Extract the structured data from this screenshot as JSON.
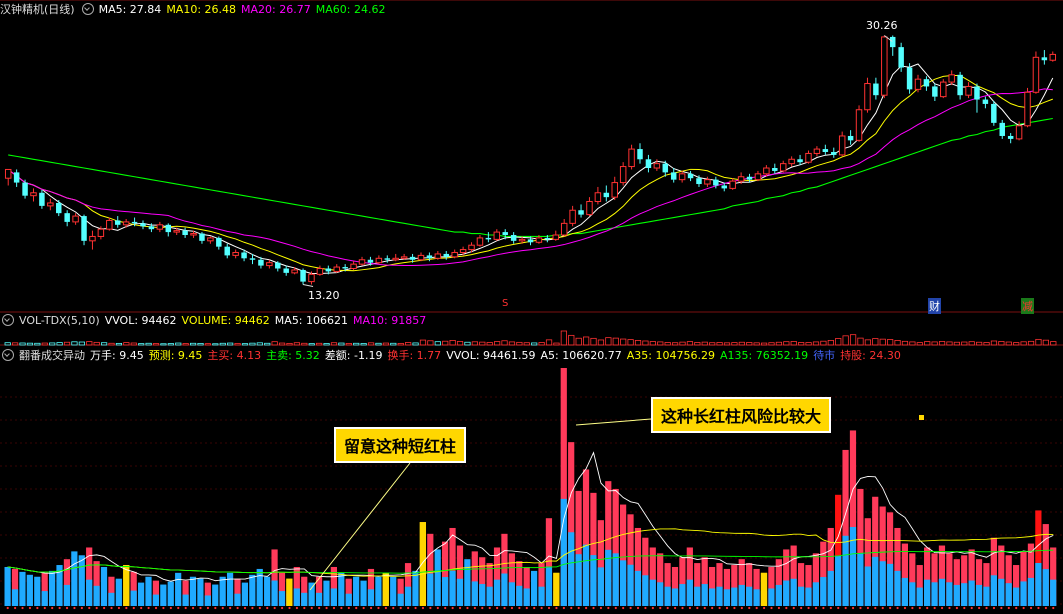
{
  "price_header": {
    "title": "汉钟精机(日线)",
    "ma5": "MA5: 27.84",
    "ma10": "MA10: 26.48",
    "ma20": "MA20: 26.77",
    "ma60": "MA60: 24.62"
  },
  "vol_header": {
    "title": "VOL-TDX(5,10)",
    "vvol": "VVOL: 94462",
    "volume": "VOLUME: 94462",
    "ma5": "MA5: 106621",
    "ma10": "MA10: 91857"
  },
  "ind_header": {
    "title": "翻番成交异动",
    "wanshou": "万手: 9.45",
    "yuce": "预测: 9.45",
    "zhumai": "主买: 4.13",
    "zhumai2": "主卖: 5.32",
    "chae": "差额: -1.19",
    "huanshou": "换手: 1.77",
    "vvol": "VVOL: 94461.59",
    "a5": "A5: 106620.77",
    "a35": "A35: 104756.29",
    "a135": "A135: 76352.19",
    "daishi": "待市",
    "chigu": "持股: 24.30"
  },
  "annotations": {
    "short_red": "留意这种短红柱",
    "long_red": "这种长红柱风险比较大"
  },
  "markers": {
    "s_mark": "S",
    "cai": "财",
    "jian": "减"
  },
  "chart_data": {
    "type": "candlestick",
    "high_label": "30.26",
    "low_label": "13.20",
    "colors": {
      "up": "#ff3232",
      "down": "#54ffff",
      "ma5": "#ffffff",
      "ma10": "#ffff00",
      "ma20": "#ff00ff",
      "ma60": "#00ff00"
    },
    "price_range": [
      12.0,
      31.5
    ],
    "candles": [
      [
        20.5,
        21.1,
        20.9,
        20.0
      ],
      [
        20.9,
        20.2,
        21.1,
        19.9
      ],
      [
        20.2,
        19.3,
        20.4,
        19.1
      ],
      [
        19.3,
        19.5,
        19.8,
        18.9
      ],
      [
        19.5,
        18.6,
        19.7,
        18.4
      ],
      [
        18.6,
        18.8,
        19.1,
        18.3
      ],
      [
        18.8,
        18.1,
        19.0,
        17.9
      ],
      [
        18.1,
        17.5,
        18.3,
        17.2
      ],
      [
        17.5,
        17.9,
        18.1,
        17.3
      ],
      [
        17.9,
        16.2,
        18.0,
        15.9
      ],
      [
        16.2,
        16.5,
        16.9,
        15.6
      ],
      [
        16.5,
        17.0,
        17.2,
        16.3
      ],
      [
        17.0,
        17.6,
        17.8,
        16.9
      ],
      [
        17.6,
        17.3,
        17.9,
        17.1
      ],
      [
        17.3,
        17.5,
        17.7,
        17.1
      ],
      [
        17.5,
        17.4,
        17.8,
        17.2
      ],
      [
        17.4,
        17.2,
        17.6,
        17.0
      ],
      [
        17.2,
        17.0,
        17.4,
        16.8
      ],
      [
        17.0,
        17.3,
        17.5,
        16.8
      ],
      [
        17.3,
        16.8,
        17.4,
        16.5
      ],
      [
        16.8,
        16.9,
        17.1,
        16.6
      ],
      [
        16.9,
        16.6,
        17.1,
        16.4
      ],
      [
        16.6,
        16.7,
        16.9,
        16.4
      ],
      [
        16.7,
        16.2,
        16.8,
        16.0
      ],
      [
        16.2,
        16.4,
        16.5,
        16.0
      ],
      [
        16.4,
        15.8,
        16.5,
        15.6
      ],
      [
        15.8,
        15.2,
        16.0,
        15.0
      ],
      [
        15.2,
        15.4,
        15.6,
        15.0
      ],
      [
        15.4,
        15.0,
        15.6,
        14.8
      ],
      [
        15.0,
        14.9,
        15.3,
        14.6
      ],
      [
        14.9,
        14.5,
        15.1,
        14.3
      ],
      [
        14.5,
        14.7,
        14.9,
        14.3
      ],
      [
        14.7,
        14.3,
        14.8,
        14.1
      ],
      [
        14.3,
        14.0,
        14.5,
        13.8
      ],
      [
        14.0,
        14.2,
        14.4,
        13.9
      ],
      [
        14.2,
        13.4,
        14.3,
        13.2
      ],
      [
        13.4,
        13.9,
        14.1,
        13.2
      ],
      [
        13.9,
        14.3,
        14.5,
        13.8
      ],
      [
        14.3,
        14.1,
        14.5,
        13.9
      ],
      [
        14.1,
        14.4,
        14.6,
        14.0
      ],
      [
        14.4,
        14.3,
        14.6,
        14.1
      ],
      [
        14.3,
        14.6,
        14.8,
        14.2
      ],
      [
        14.6,
        14.9,
        15.1,
        14.5
      ],
      [
        14.9,
        14.7,
        15.1,
        14.5
      ],
      [
        14.7,
        15.0,
        15.2,
        14.6
      ],
      [
        15.0,
        14.9,
        15.2,
        14.7
      ],
      [
        14.9,
        15.0,
        15.3,
        14.8
      ],
      [
        15.0,
        15.1,
        15.3,
        14.9
      ],
      [
        15.1,
        14.9,
        15.3,
        14.7
      ],
      [
        14.9,
        15.2,
        15.4,
        14.8
      ],
      [
        15.2,
        15.0,
        15.4,
        14.8
      ],
      [
        15.0,
        15.3,
        15.5,
        14.9
      ],
      [
        15.3,
        15.1,
        15.5,
        14.9
      ],
      [
        15.1,
        15.4,
        15.6,
        15.0
      ],
      [
        15.4,
        15.6,
        15.8,
        15.2
      ],
      [
        15.6,
        15.9,
        16.1,
        15.4
      ],
      [
        15.9,
        16.4,
        16.6,
        15.8
      ],
      [
        16.4,
        16.3,
        16.8,
        16.1
      ],
      [
        16.3,
        16.8,
        17.0,
        16.2
      ],
      [
        16.8,
        16.6,
        17.0,
        16.3
      ],
      [
        16.6,
        16.2,
        16.8,
        16.0
      ],
      [
        16.2,
        16.3,
        16.5,
        16.0
      ],
      [
        16.3,
        16.1,
        16.5,
        15.9
      ],
      [
        16.1,
        16.4,
        16.6,
        16.0
      ],
      [
        16.4,
        16.3,
        16.6,
        16.1
      ],
      [
        16.3,
        16.6,
        16.9,
        16.2
      ],
      [
        16.6,
        17.4,
        17.7,
        16.5
      ],
      [
        17.4,
        18.3,
        18.6,
        17.2
      ],
      [
        18.3,
        18.0,
        18.7,
        17.8
      ],
      [
        18.0,
        18.9,
        19.2,
        17.9
      ],
      [
        18.9,
        19.5,
        19.9,
        18.7
      ],
      [
        19.5,
        19.2,
        20.0,
        18.9
      ],
      [
        19.2,
        20.2,
        20.6,
        19.0
      ],
      [
        20.2,
        21.3,
        21.6,
        20.0
      ],
      [
        21.3,
        22.5,
        22.8,
        21.1
      ],
      [
        22.5,
        21.8,
        22.9,
        21.5
      ],
      [
        21.8,
        21.2,
        22.1,
        20.9
      ],
      [
        21.2,
        21.5,
        21.8,
        21.0
      ],
      [
        21.5,
        20.9,
        21.7,
        20.6
      ],
      [
        20.9,
        20.4,
        21.2,
        20.2
      ],
      [
        20.4,
        20.8,
        21.0,
        20.2
      ],
      [
        20.8,
        20.5,
        21.0,
        20.3
      ],
      [
        20.5,
        20.1,
        20.7,
        19.9
      ],
      [
        20.1,
        20.4,
        20.6,
        19.9
      ],
      [
        20.4,
        20.0,
        20.6,
        19.8
      ],
      [
        20.0,
        19.8,
        20.2,
        19.6
      ],
      [
        19.8,
        20.3,
        20.5,
        19.7
      ],
      [
        20.3,
        20.6,
        20.9,
        20.1
      ],
      [
        20.6,
        20.4,
        20.8,
        20.2
      ],
      [
        20.4,
        20.8,
        21.0,
        20.3
      ],
      [
        20.8,
        21.2,
        21.4,
        20.6
      ],
      [
        21.2,
        21.0,
        21.5,
        20.8
      ],
      [
        21.0,
        21.5,
        21.7,
        20.9
      ],
      [
        21.5,
        21.8,
        22.0,
        21.3
      ],
      [
        21.8,
        21.6,
        22.1,
        21.4
      ],
      [
        21.6,
        22.2,
        22.4,
        21.5
      ],
      [
        22.2,
        22.5,
        22.7,
        22.0
      ],
      [
        22.5,
        22.3,
        22.8,
        22.1
      ],
      [
        22.3,
        22.1,
        22.6,
        21.9
      ],
      [
        22.1,
        23.4,
        23.7,
        22.0
      ],
      [
        23.4,
        23.1,
        23.8,
        22.8
      ],
      [
        23.1,
        25.2,
        25.5,
        23.0
      ],
      [
        25.2,
        27.0,
        27.4,
        25.0
      ],
      [
        27.0,
        26.2,
        27.4,
        25.9
      ],
      [
        26.2,
        30.2,
        30.3,
        26.0
      ],
      [
        30.2,
        29.5,
        30.3,
        28.9
      ],
      [
        29.5,
        28.1,
        29.8,
        27.8
      ],
      [
        28.1,
        26.6,
        28.4,
        26.3
      ],
      [
        26.6,
        27.3,
        27.6,
        26.4
      ],
      [
        27.3,
        26.8,
        27.5,
        26.5
      ],
      [
        26.8,
        26.1,
        27.0,
        25.8
      ],
      [
        26.1,
        27.1,
        27.3,
        26.0
      ],
      [
        27.1,
        27.6,
        27.9,
        26.9
      ],
      [
        27.6,
        26.2,
        27.8,
        25.9
      ],
      [
        26.2,
        26.8,
        27.1,
        26.0
      ],
      [
        26.8,
        25.9,
        27.0,
        25.0
      ],
      [
        25.9,
        25.6,
        26.1,
        25.3
      ],
      [
        25.6,
        24.3,
        25.8,
        24.1
      ],
      [
        24.3,
        23.4,
        24.5,
        23.2
      ],
      [
        23.4,
        23.2,
        23.6,
        22.9
      ],
      [
        23.2,
        24.1,
        24.4,
        23.1
      ],
      [
        24.1,
        26.4,
        26.7,
        24.0
      ],
      [
        26.4,
        28.8,
        29.2,
        26.3
      ],
      [
        28.8,
        28.6,
        29.3,
        28.3
      ],
      [
        28.6,
        29.0,
        29.2,
        28.5
      ]
    ],
    "ma60": [
      22.1,
      22.0,
      21.9,
      21.8,
      21.7,
      21.6,
      21.5,
      21.4,
      21.3,
      21.2,
      21.1,
      21.0,
      20.9,
      20.8,
      20.7,
      20.6,
      20.5,
      20.4,
      20.3,
      20.2,
      20.1,
      20.0,
      19.9,
      19.8,
      19.7,
      19.6,
      19.5,
      19.4,
      19.3,
      19.2,
      19.1,
      19.0,
      18.9,
      18.8,
      18.7,
      18.6,
      18.5,
      18.4,
      18.3,
      18.2,
      18.1,
      18.0,
      17.9,
      17.8,
      17.7,
      17.6,
      17.5,
      17.4,
      17.3,
      17.2,
      17.1,
      17.0,
      16.9,
      16.8,
      16.8,
      16.7,
      16.7,
      16.6,
      16.6,
      16.5,
      16.5,
      16.5,
      16.5,
      16.5,
      16.5,
      16.6,
      16.6,
      16.7,
      16.7,
      16.8,
      16.9,
      17.0,
      17.1,
      17.2,
      17.3,
      17.4,
      17.5,
      17.6,
      17.7,
      17.8,
      17.9,
      18.0,
      18.1,
      18.2,
      18.3,
      18.4,
      18.6,
      18.7,
      18.8,
      18.9,
      19.1,
      19.2,
      19.3,
      19.5,
      19.6,
      19.8,
      19.9,
      20.1,
      20.3,
      20.5,
      20.7,
      20.9,
      21.1,
      21.3,
      21.5,
      21.7,
      21.9,
      22.1,
      22.3,
      22.5,
      22.7,
      22.9,
      23.1,
      23.2,
      23.4,
      23.5,
      23.7,
      23.8,
      24.0,
      24.1,
      24.2,
      24.3,
      24.4,
      24.5,
      24.6
    ],
    "vol_bars": [
      [
        40,
        "b"
      ],
      [
        38,
        "r"
      ],
      [
        35,
        "b"
      ],
      [
        32,
        "b"
      ],
      [
        30,
        "b"
      ],
      [
        34,
        "r"
      ],
      [
        36,
        "b"
      ],
      [
        42,
        "b"
      ],
      [
        48,
        "r"
      ],
      [
        56,
        "b"
      ],
      [
        52,
        "b"
      ],
      [
        60,
        "r"
      ],
      [
        46,
        "r"
      ],
      [
        40,
        "b"
      ],
      [
        30,
        "r"
      ],
      [
        28,
        "b"
      ],
      [
        42,
        "y"
      ],
      [
        35,
        "r"
      ],
      [
        24,
        "b"
      ],
      [
        30,
        "b"
      ],
      [
        26,
        "r"
      ],
      [
        22,
        "b"
      ],
      [
        25,
        "b"
      ],
      [
        34,
        "b"
      ],
      [
        26,
        "r"
      ],
      [
        30,
        "b"
      ],
      [
        28,
        "b"
      ],
      [
        24,
        "r"
      ],
      [
        22,
        "b"
      ],
      [
        30,
        "b"
      ],
      [
        34,
        "b"
      ],
      [
        28,
        "r"
      ],
      [
        24,
        "b"
      ],
      [
        32,
        "b"
      ],
      [
        38,
        "b"
      ],
      [
        30,
        "b"
      ],
      [
        58,
        "r"
      ],
      [
        34,
        "r"
      ],
      [
        28,
        "y"
      ],
      [
        40,
        "r"
      ],
      [
        30,
        "r"
      ],
      [
        24,
        "b"
      ],
      [
        30,
        "r"
      ],
      [
        26,
        "b"
      ],
      [
        40,
        "r"
      ],
      [
        34,
        "b"
      ],
      [
        28,
        "r"
      ],
      [
        30,
        "b"
      ],
      [
        26,
        "b"
      ],
      [
        38,
        "r"
      ],
      [
        30,
        "b"
      ],
      [
        34,
        "y"
      ],
      [
        30,
        "b"
      ],
      [
        28,
        "r"
      ],
      [
        44,
        "r"
      ],
      [
        36,
        "b"
      ],
      [
        86,
        "y"
      ],
      [
        74,
        "r"
      ],
      [
        58,
        "b"
      ],
      [
        66,
        "r"
      ],
      [
        80,
        "r"
      ],
      [
        62,
        "r"
      ],
      [
        48,
        "b"
      ],
      [
        56,
        "r"
      ],
      [
        50,
        "r"
      ],
      [
        44,
        "r"
      ],
      [
        60,
        "r"
      ],
      [
        74,
        "r"
      ],
      [
        54,
        "r"
      ],
      [
        46,
        "r"
      ],
      [
        40,
        "r"
      ],
      [
        36,
        "b"
      ],
      [
        44,
        "r"
      ],
      [
        90,
        "r"
      ],
      [
        34,
        "y"
      ],
      [
        244,
        "r"
      ],
      [
        168,
        "r"
      ],
      [
        118,
        "r"
      ],
      [
        140,
        "r"
      ],
      [
        116,
        "r"
      ],
      [
        88,
        "r"
      ],
      [
        128,
        "r"
      ],
      [
        120,
        "r"
      ],
      [
        104,
        "r"
      ],
      [
        94,
        "r"
      ],
      [
        80,
        "r"
      ],
      [
        70,
        "r"
      ],
      [
        60,
        "r"
      ],
      [
        54,
        "r"
      ],
      [
        44,
        "r"
      ],
      [
        40,
        "r"
      ],
      [
        50,
        "r"
      ],
      [
        60,
        "r"
      ],
      [
        44,
        "r"
      ],
      [
        50,
        "r"
      ],
      [
        40,
        "r"
      ],
      [
        44,
        "r"
      ],
      [
        38,
        "r"
      ],
      [
        42,
        "r"
      ],
      [
        48,
        "r"
      ],
      [
        44,
        "r"
      ],
      [
        38,
        "r"
      ],
      [
        34,
        "y"
      ],
      [
        40,
        "r"
      ],
      [
        48,
        "r"
      ],
      [
        58,
        "r"
      ],
      [
        62,
        "r"
      ],
      [
        44,
        "r"
      ],
      [
        42,
        "r"
      ],
      [
        54,
        "r"
      ],
      [
        66,
        "r"
      ],
      [
        80,
        "r"
      ],
      [
        114,
        "R"
      ],
      [
        160,
        "r"
      ],
      [
        180,
        "r"
      ],
      [
        120,
        "r"
      ],
      [
        90,
        "r"
      ],
      [
        112,
        "r"
      ],
      [
        102,
        "r"
      ],
      [
        96,
        "r"
      ],
      [
        80,
        "r"
      ],
      [
        64,
        "r"
      ],
      [
        54,
        "r"
      ],
      [
        42,
        "r"
      ],
      [
        60,
        "r"
      ],
      [
        54,
        "r"
      ],
      [
        62,
        "r"
      ],
      [
        54,
        "r"
      ],
      [
        48,
        "r"
      ],
      [
        52,
        "r"
      ],
      [
        58,
        "r"
      ],
      [
        48,
        "r"
      ],
      [
        44,
        "r"
      ],
      [
        70,
        "r"
      ],
      [
        62,
        "r"
      ],
      [
        52,
        "r"
      ],
      [
        42,
        "r"
      ],
      [
        56,
        "r"
      ],
      [
        64,
        "r"
      ],
      [
        98,
        "R"
      ],
      [
        84,
        "r"
      ],
      [
        60,
        "r"
      ]
    ]
  }
}
